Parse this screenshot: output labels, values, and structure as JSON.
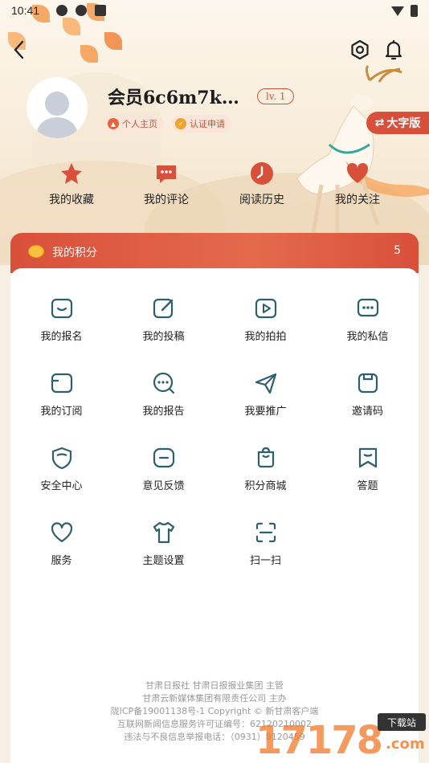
{
  "status_bar": {
    "time": "10:41"
  },
  "profile": {
    "username": "会员6c6m7k…",
    "level": "lv. 1",
    "chip_homepage": "个人主页",
    "chip_certify": "认证申请",
    "large_font_button": "大字版"
  },
  "quick_actions": [
    {
      "label": "我的收藏",
      "icon": "star-icon"
    },
    {
      "label": "我的评论",
      "icon": "comment-icon"
    },
    {
      "label": "阅读历史",
      "icon": "clock-icon"
    },
    {
      "label": "我的关注",
      "icon": "heart-icon"
    }
  ],
  "points": {
    "label": "我的积分",
    "value": "5"
  },
  "grid": [
    {
      "label": "我的报名",
      "icon": "signup-icon"
    },
    {
      "label": "我的投稿",
      "icon": "edit-icon"
    },
    {
      "label": "我的拍拍",
      "icon": "video-icon"
    },
    {
      "label": "我的私信",
      "icon": "message-icon"
    },
    {
      "label": "我的订阅",
      "icon": "subscribe-icon"
    },
    {
      "label": "我的报告",
      "icon": "report-icon"
    },
    {
      "label": "我要推广",
      "icon": "send-icon"
    },
    {
      "label": "邀请码",
      "icon": "invite-icon"
    },
    {
      "label": "安全中心",
      "icon": "shield-icon"
    },
    {
      "label": "意见反馈",
      "icon": "feedback-icon"
    },
    {
      "label": "积分商城",
      "icon": "shop-icon"
    },
    {
      "label": "答题",
      "icon": "quiz-icon"
    },
    {
      "label": "服务",
      "icon": "service-heart-icon"
    },
    {
      "label": "主题设置",
      "icon": "shirt-icon"
    },
    {
      "label": "扫一扫",
      "icon": "scan-icon"
    }
  ],
  "footer": {
    "line1": "甘肃日报社  甘肃日报报业集团  主管",
    "line2": "甘肃云新媒体集团有限责任公司  主办",
    "line3": "陇ICP备19001138号-1   Copyright © 新甘肃客户端",
    "line4": "互联网新闻信息服务许可证编号：62120210002",
    "line5": "违法与不良信息举报电话：（0931）8120459"
  },
  "watermark": {
    "number": "17178",
    "domain": ".com",
    "tag": "下载站"
  },
  "colors": {
    "accent": "#d9503a",
    "icon_teal": "#2e5f6e",
    "chip_bg": "#f9e6d8"
  }
}
